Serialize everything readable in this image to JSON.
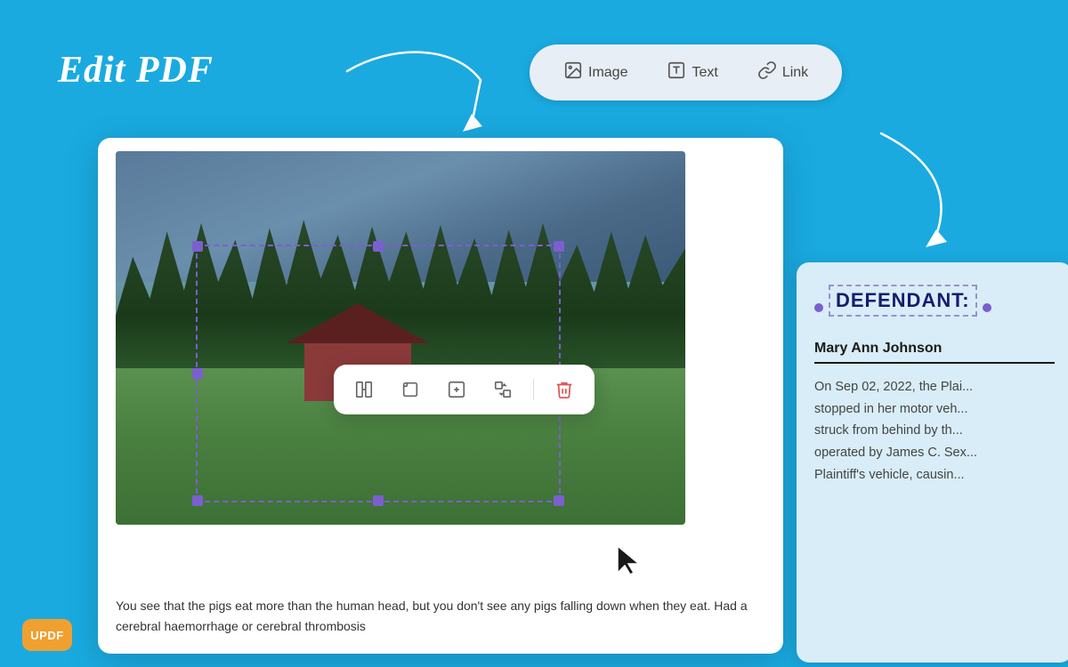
{
  "page": {
    "title": "Edit PDF",
    "background_color": "#1aaae0"
  },
  "toolbar": {
    "tabs": [
      {
        "id": "image",
        "label": "Image",
        "icon": "image-icon"
      },
      {
        "id": "text",
        "label": "Text",
        "icon": "text-icon"
      },
      {
        "id": "link",
        "label": "Link",
        "icon": "link-icon"
      }
    ]
  },
  "image_tools": [
    {
      "id": "replace",
      "label": "Replace Image",
      "icon": "replace-icon"
    },
    {
      "id": "crop",
      "label": "Crop",
      "icon": "crop-icon"
    },
    {
      "id": "extract",
      "label": "Extract",
      "icon": "extract-icon"
    },
    {
      "id": "convert",
      "label": "Convert",
      "icon": "convert-icon"
    },
    {
      "id": "delete",
      "label": "Delete",
      "icon": "trash-icon"
    }
  ],
  "pdf_content": {
    "body_text": "You see that the pigs eat more than the human head, but you don't see any pigs falling down when they eat. Had a cerebral haemorrhage or cerebral thrombosis"
  },
  "right_panel": {
    "label": "DEFENDANT:",
    "name": "Mary Ann Johnson",
    "body_text": "On Sep 02, 2022, the Plai... stopped in her motor veh... struck from behind by th... operated by James C. Sex... Plaintiff's vehicle, causin..."
  },
  "logo": {
    "text": "UPDF"
  }
}
